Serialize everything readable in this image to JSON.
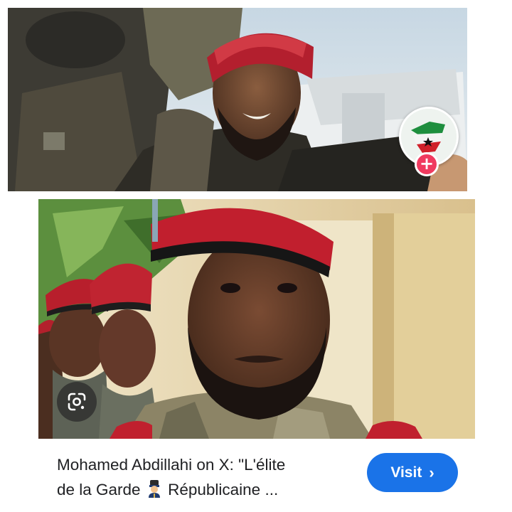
{
  "result": {
    "title_line1": "Mohamed Abdillahi on X: \"L'élite",
    "title_line2_a": "de la Garde",
    "title_line2_b": "Républicaine ...",
    "emoji_icon": "guardsman-emoji",
    "visit_label": "Visit",
    "visit_chevron": "›"
  },
  "badges": {
    "plus_symbol": "+",
    "lens_icon": "lens-icon",
    "avatar_icon": "somaliland-flag-map-icon"
  },
  "colors": {
    "visit_button": "#1a73e8",
    "plus_badge": "#f03a5f",
    "caption_text": "#202124"
  }
}
